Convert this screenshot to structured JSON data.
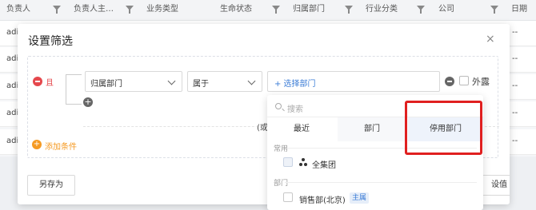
{
  "table": {
    "columns": [
      {
        "label": "负责人",
        "has_filter": true
      },
      {
        "label": "负责人主…",
        "has_filter": true
      },
      {
        "label": "业务类型",
        "has_filter": false
      },
      {
        "label": "生命状态",
        "has_filter": true
      },
      {
        "label": "归属部门",
        "has_filter": true
      },
      {
        "label": "行业分类",
        "has_filter": true
      },
      {
        "label": "公司",
        "has_filter": true
      },
      {
        "label": "日期",
        "has_filter": false
      }
    ],
    "rows": [
      {
        "left": "adi",
        "right": "--"
      },
      {
        "left": "adi",
        "right": "--"
      },
      {
        "left": "adi",
        "right": "--"
      },
      {
        "left": "adi",
        "right": "--"
      },
      {
        "left": "adi",
        "right": "--"
      }
    ]
  },
  "modal": {
    "title": "设置筛选",
    "close_symbol": "×",
    "and_label": "且",
    "field_value": "归属部门",
    "operator_value": "属于",
    "value_placeholder": "+ 选择部门",
    "external_label": "外露",
    "or_label": "(或",
    "add_condition_label": "添加条件",
    "add_icon_symbol": "+",
    "save_as_label": "另存为",
    "right_button_label": "设值"
  },
  "dropdown": {
    "search_placeholder": "搜索",
    "tabs": [
      {
        "label": "最近",
        "state": "active"
      },
      {
        "label": "部门",
        "state": "normal"
      },
      {
        "label": "停用部门",
        "state": "highlighted"
      }
    ],
    "sections": [
      {
        "title": "常用",
        "items": [
          {
            "label": "全集团",
            "icon": "org-icon",
            "badge": ""
          }
        ]
      },
      {
        "title": "部门",
        "items": [
          {
            "label": "销售部(北京)",
            "icon": "",
            "badge": "主属"
          }
        ]
      }
    ]
  },
  "colors": {
    "danger": "#e5484d",
    "link": "#3b7cd6",
    "warning": "#f59a23",
    "highlight_border": "#e02020"
  }
}
